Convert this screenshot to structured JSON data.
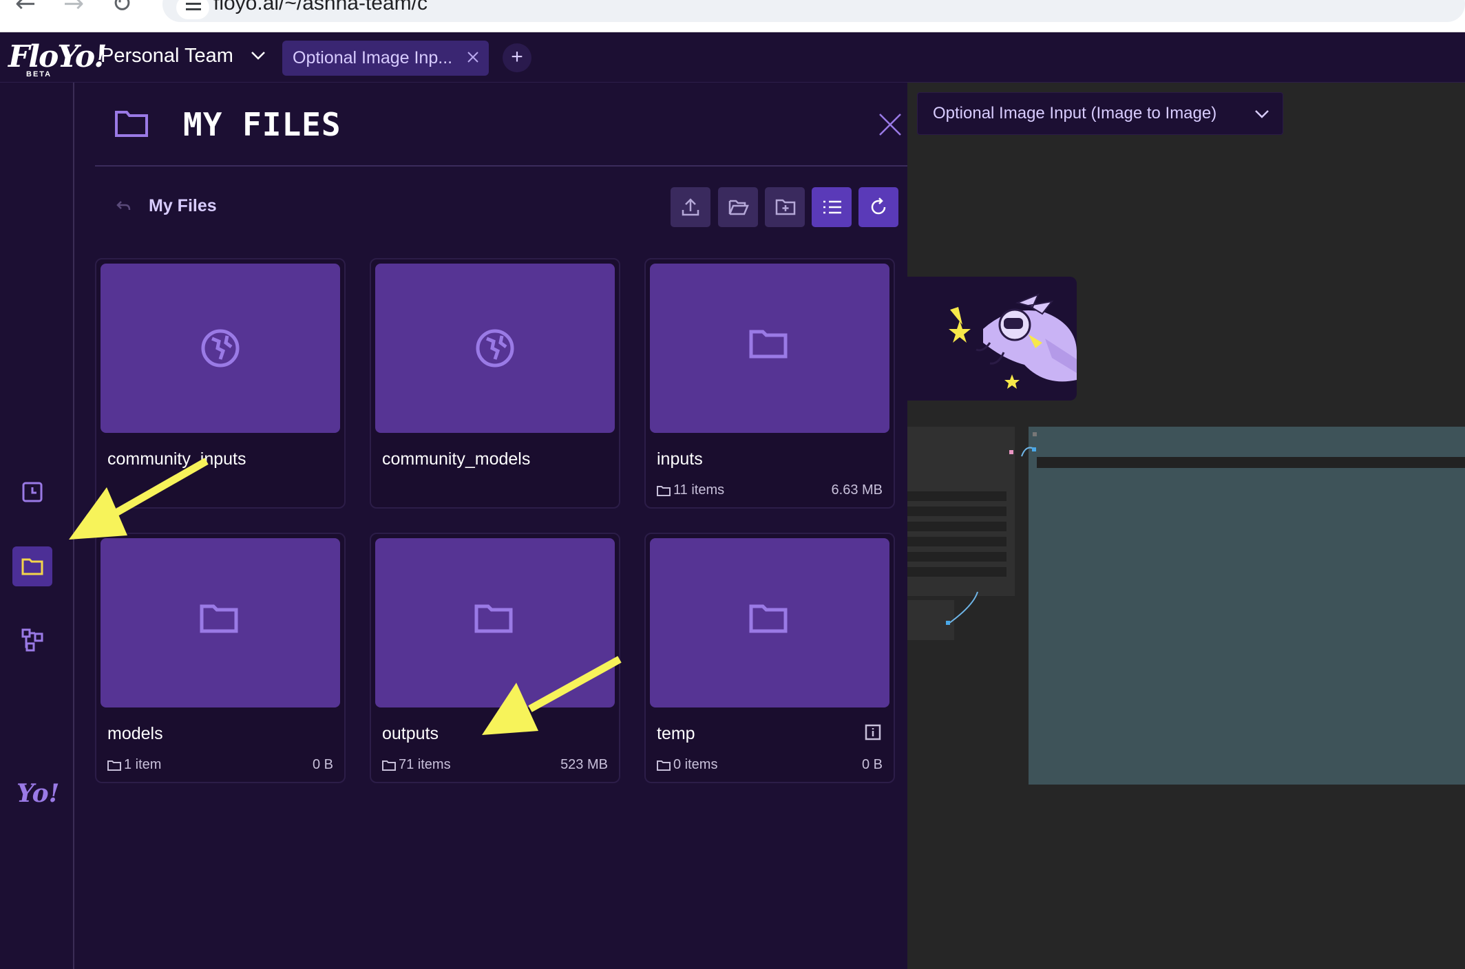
{
  "browser": {
    "url": "floyo.ai/~/ashna-team/c"
  },
  "app": {
    "logo_text": "FloYo!",
    "logo_badge": "BETA",
    "team_name": "Personal Team",
    "active_tab_label": "Optional Image Inp...",
    "add_tab_label": "+",
    "rail_brand_text": "Yo!"
  },
  "files_panel": {
    "title": "MY FILES",
    "breadcrumb": "My Files",
    "toolbar": [
      "upload-icon",
      "open-folder-icon",
      "new-folder-icon",
      "list-view-icon",
      "refresh-icon"
    ],
    "folders": [
      {
        "name": "community_inputs",
        "icon": "globe-icon",
        "count": "",
        "size": ""
      },
      {
        "name": "community_models",
        "icon": "globe-icon",
        "count": "",
        "size": ""
      },
      {
        "name": "inputs",
        "icon": "folder-icon",
        "count": "11 items",
        "size": "6.63 MB"
      },
      {
        "name": "models",
        "icon": "folder-icon",
        "count": "1 item",
        "size": "0 B"
      },
      {
        "name": "outputs",
        "icon": "folder-icon",
        "count": "71 items",
        "size": "523 MB"
      },
      {
        "name": "temp",
        "icon": "folder-icon",
        "count": "0 items",
        "size": "0 B"
      }
    ]
  },
  "canvas": {
    "workflow_select": "Optional Image Input (Image to Image)"
  },
  "colors": {
    "background": "#1c0f33",
    "card_thumb": "#563494",
    "accent": "#5a3ab8",
    "canvas": "#262626",
    "node_teal": "#3e5359",
    "annotation_arrow": "#f7f35a"
  }
}
